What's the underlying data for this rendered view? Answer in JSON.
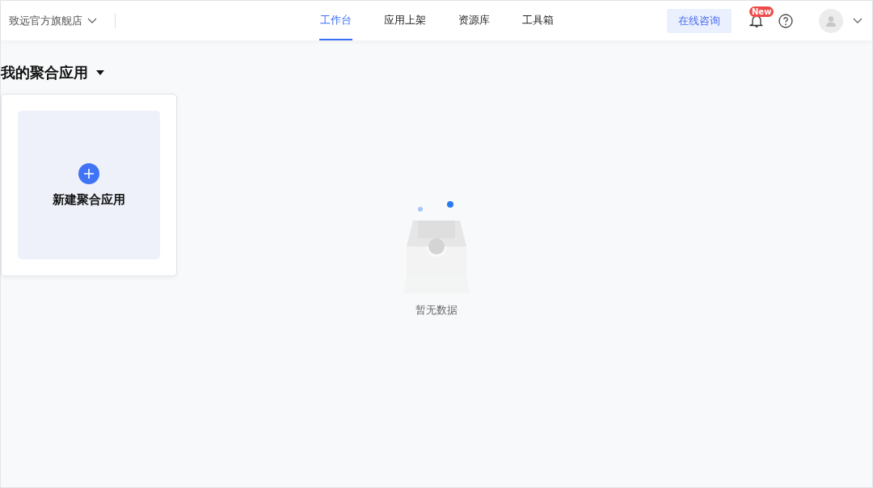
{
  "header": {
    "store": "致远官方旗舰店",
    "tabs": [
      {
        "label": "工作台",
        "selected": true
      },
      {
        "label": "应用上架",
        "selected": false
      },
      {
        "label": "资源库",
        "selected": false
      },
      {
        "label": "工具箱",
        "selected": false
      }
    ],
    "consult_button": "在线咨询",
    "badge": "New"
  },
  "section_title": "我的聚合应用",
  "new_card": {
    "label": "新建聚合应用"
  },
  "empty_state": {
    "text": "暂无数据"
  }
}
